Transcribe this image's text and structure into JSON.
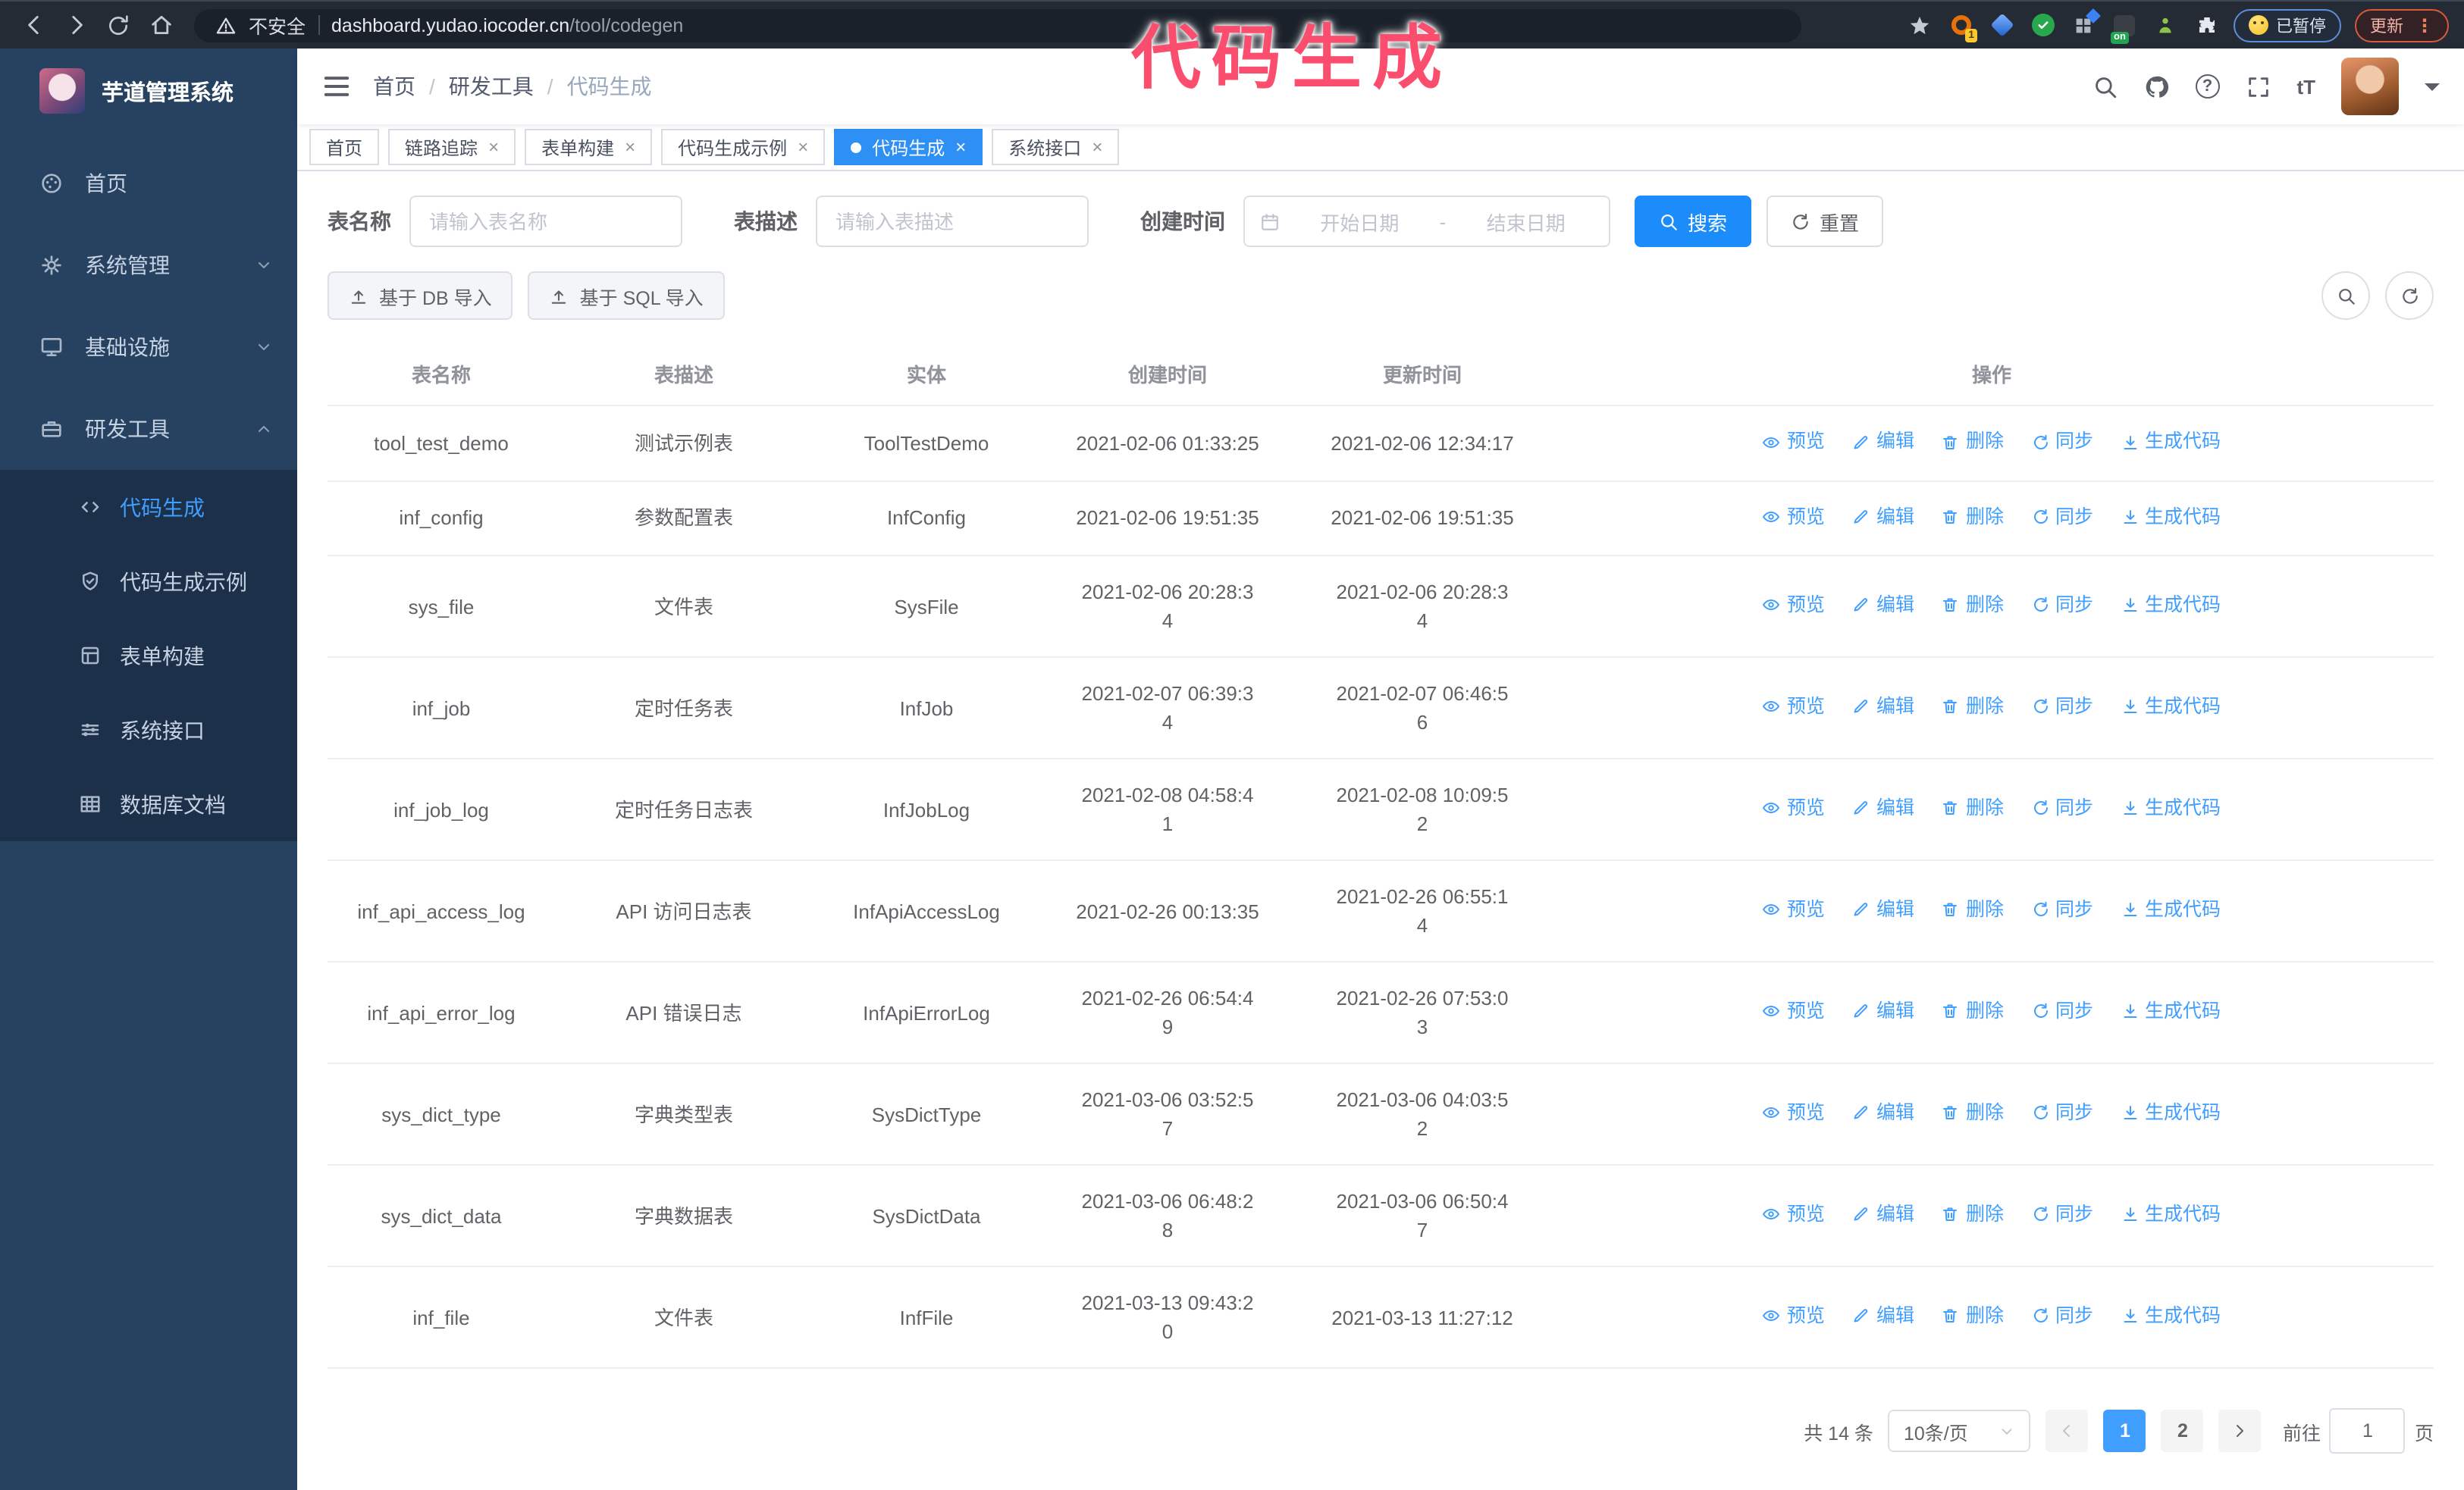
{
  "colors": {
    "accent": "#409eff",
    "primary_button": "#1b8cfa",
    "annotation": "#fb4d6d",
    "sidebar_bg": "#264260",
    "submenu_bg": "#1d3049",
    "tag_active": "#2e90f5"
  },
  "annotation": {
    "text": "代码生成"
  },
  "browser": {
    "security_label": "不安全",
    "url_host": "dashboard.yudao.iocoder.cn",
    "url_path": "/tool/codegen",
    "ext_badge_count": "1",
    "ext_badge_on": "on",
    "paused_label": "已暂停",
    "update_label": "更新"
  },
  "sidebar": {
    "title": "芋道管理系统",
    "menu": [
      {
        "label": "首页",
        "icon": "dashboard-icon"
      },
      {
        "label": "系统管理",
        "icon": "gear-icon"
      },
      {
        "label": "基础设施",
        "icon": "monitor-icon"
      },
      {
        "label": "研发工具",
        "icon": "toolbox-icon"
      }
    ],
    "submenu": [
      {
        "label": "代码生成",
        "icon": "code-icon",
        "active": true
      },
      {
        "label": "代码生成示例",
        "icon": "shield-check-icon"
      },
      {
        "label": "表单构建",
        "icon": "form-icon"
      },
      {
        "label": "系统接口",
        "icon": "sliders-icon"
      },
      {
        "label": "数据库文档",
        "icon": "database-table-icon"
      }
    ]
  },
  "navbar": {
    "breadcrumb": [
      "首页",
      "研发工具",
      "代码生成"
    ]
  },
  "tabs": [
    {
      "label": "首页",
      "closable": false
    },
    {
      "label": "链路追踪",
      "closable": true
    },
    {
      "label": "表单构建",
      "closable": true
    },
    {
      "label": "代码生成示例",
      "closable": true
    },
    {
      "label": "代码生成",
      "closable": true,
      "active": true
    },
    {
      "label": "系统接口",
      "closable": true
    }
  ],
  "search": {
    "name_label": "表名称",
    "name_placeholder": "请输入表名称",
    "desc_label": "表描述",
    "desc_placeholder": "请输入表描述",
    "time_label": "创建时间",
    "start_placeholder": "开始日期",
    "range_separator": "-",
    "end_placeholder": "结束日期",
    "search_label": "搜索",
    "reset_label": "重置"
  },
  "toolbar": {
    "import_db_label": "基于 DB 导入",
    "import_sql_label": "基于 SQL 导入"
  },
  "table": {
    "headers": [
      "表名称",
      "表描述",
      "实体",
      "创建时间",
      "更新时间",
      "操作"
    ],
    "actions": [
      {
        "label": "预览",
        "icon": "eye-icon"
      },
      {
        "label": "编辑",
        "icon": "edit-icon"
      },
      {
        "label": "删除",
        "icon": "trash-icon"
      },
      {
        "label": "同步",
        "icon": "sync-icon"
      },
      {
        "label": "生成代码",
        "icon": "download-icon"
      }
    ],
    "rows": [
      {
        "name": "tool_test_demo",
        "desc": "测试示例表",
        "entity": "ToolTestDemo",
        "created": "2021-02-06 01:33:25",
        "updated": "2021-02-06 12:34:17"
      },
      {
        "name": "inf_config",
        "desc": "参数配置表",
        "entity": "InfConfig",
        "created": "2021-02-06 19:51:35",
        "updated": "2021-02-06 19:51:35"
      },
      {
        "name": "sys_file",
        "desc": "文件表",
        "entity": "SysFile",
        "created": "2021-02-06 20:28:3\n4",
        "updated": "2021-02-06 20:28:3\n4"
      },
      {
        "name": "inf_job",
        "desc": "定时任务表",
        "entity": "InfJob",
        "created": "2021-02-07 06:39:3\n4",
        "updated": "2021-02-07 06:46:5\n6"
      },
      {
        "name": "inf_job_log",
        "desc": "定时任务日志表",
        "entity": "InfJobLog",
        "created": "2021-02-08 04:58:4\n1",
        "updated": "2021-02-08 10:09:5\n2"
      },
      {
        "name": "inf_api_access_log",
        "desc": "API 访问日志表",
        "entity": "InfApiAccessLog",
        "created": "2021-02-26 00:13:35",
        "updated": "2021-02-26 06:55:1\n4"
      },
      {
        "name": "inf_api_error_log",
        "desc": "API 错误日志",
        "entity": "InfApiErrorLog",
        "created": "2021-02-26 06:54:4\n9",
        "updated": "2021-02-26 07:53:0\n3"
      },
      {
        "name": "sys_dict_type",
        "desc": "字典类型表",
        "entity": "SysDictType",
        "created": "2021-03-06 03:52:5\n7",
        "updated": "2021-03-06 04:03:5\n2"
      },
      {
        "name": "sys_dict_data",
        "desc": "字典数据表",
        "entity": "SysDictData",
        "created": "2021-03-06 06:48:2\n8",
        "updated": "2021-03-06 06:50:4\n7"
      },
      {
        "name": "inf_file",
        "desc": "文件表",
        "entity": "InfFile",
        "created": "2021-03-13 09:43:2\n0",
        "updated": "2021-03-13 11:27:12"
      }
    ]
  },
  "pagination": {
    "total": "共 14 条",
    "page_size": "10条/页",
    "pages": [
      "1",
      "2"
    ],
    "active_page": "1",
    "goto_label": "前往",
    "goto_value": "1",
    "goto_suffix": "页"
  }
}
